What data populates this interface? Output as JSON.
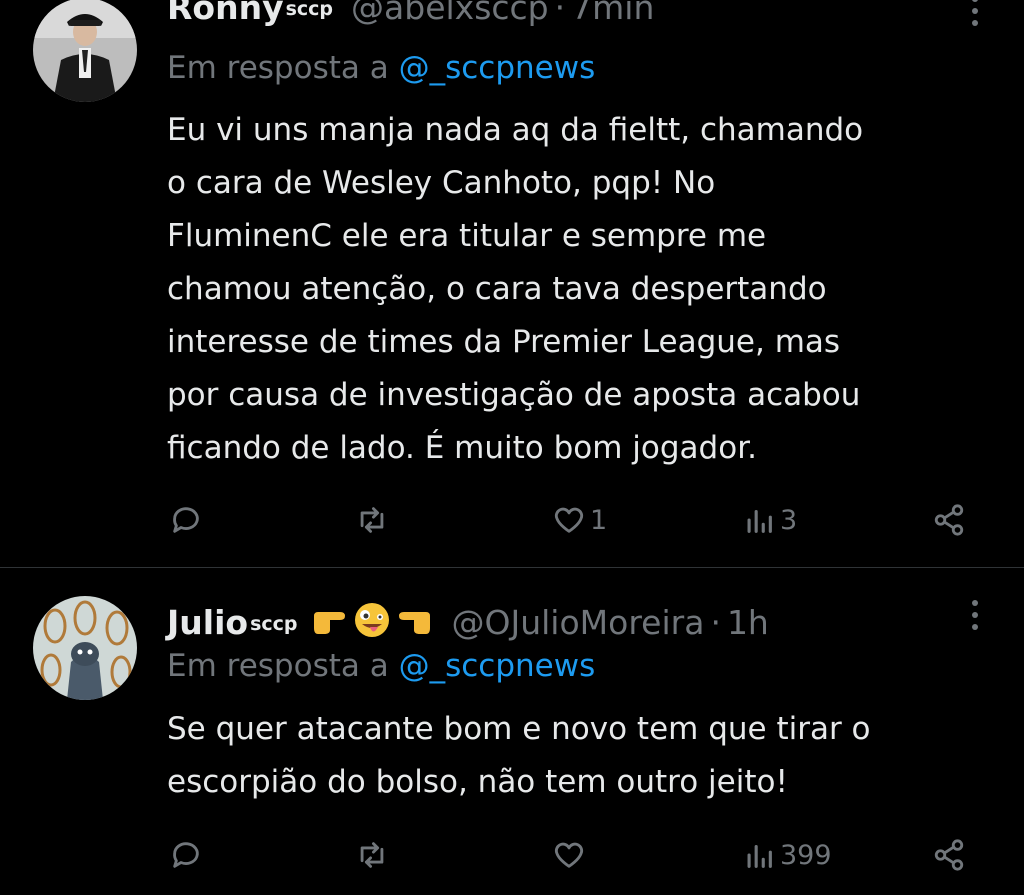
{
  "tweets": [
    {
      "display_name": "Ronny",
      "name_suffix": "sccp",
      "handle": "@abelxsccp",
      "separator": "·",
      "time": "7min",
      "reply_prefix": "Em resposta a",
      "reply_to": "@_sccpnews",
      "body": "Eu vi uns manja nada aq da fieltt, chamando\no cara de Wesley Canhoto, pqp! No\nFluminenC ele era titular e sempre me\nchamou atenção, o cara tava despertando\ninteresse de times da Premier League, mas\npor causa de investigação de aposta acabou\nficando de lado. É muito bom jogador.",
      "actions": {
        "reply_count": "",
        "retweet_count": "",
        "like_count": "1",
        "views_count": "3"
      }
    },
    {
      "display_name": "Julio",
      "name_suffix": "sccp",
      "emojis": [
        "pointing-right-hand-icon",
        "zany-face-icon",
        "pointing-left-hand-icon"
      ],
      "handle": "@OJulioMoreira",
      "separator": "·",
      "time": "1h",
      "reply_prefix": "Em resposta a",
      "reply_to": "@_sccpnews",
      "body": "Se quer atacante bom e novo tem que tirar o\nescorpião do bolso, não tem outro jeito!",
      "actions": {
        "reply_count": "",
        "retweet_count": "",
        "like_count": "",
        "views_count": "399"
      }
    }
  ],
  "colors": {
    "background": "#000000",
    "text": "#e7e9ea",
    "muted": "#71767b",
    "link": "#1d9bf0",
    "divider": "#2f3336"
  }
}
